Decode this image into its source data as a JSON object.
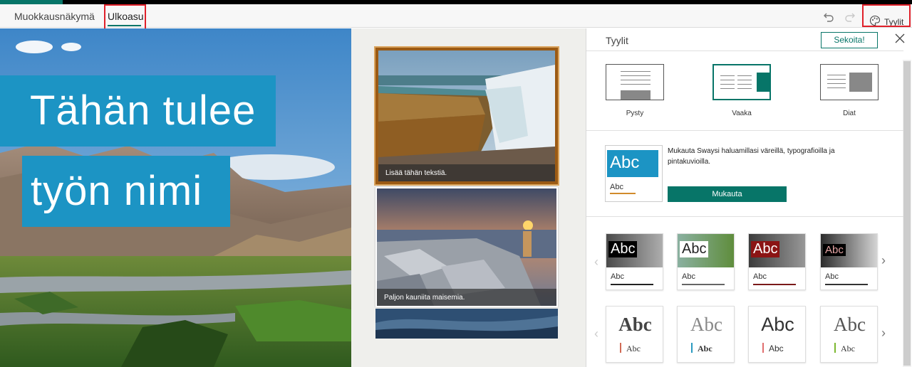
{
  "topbar": {
    "tab_edit": "Muokkausnäkymä",
    "tab_layout": "Ulkoasu",
    "undo_icon": "undo-icon",
    "redo_icon": "redo-icon",
    "styles_button": "Tyylit",
    "styles_icon": "palette-icon"
  },
  "canvas": {
    "title_line1": "Tähän tulee",
    "title_line2": "työn nimi",
    "card1_caption": "Lisää tähän tekstiä.",
    "card2_caption": "Paljon kauniita maisemia."
  },
  "panel": {
    "title": "Tyylit",
    "shuffle": "Sekoita!",
    "close_icon": "close-icon",
    "layouts": [
      {
        "label": "Pysty"
      },
      {
        "label": "Vaaka"
      },
      {
        "label": "Diat"
      }
    ],
    "customize_desc": "Mukauta Swaysi haluamillasi väreillä, typografioilla ja pintakuvioilla.",
    "customize_button": "Mukauta",
    "abc_big": "Abc",
    "abc_small": "Abc",
    "prev_icon": "chevron-left-icon",
    "next_icon": "chevron-right-icon"
  },
  "colors": {
    "accent": "#077568",
    "title_box": "#1c94c4",
    "highlight": "#e0202a"
  }
}
